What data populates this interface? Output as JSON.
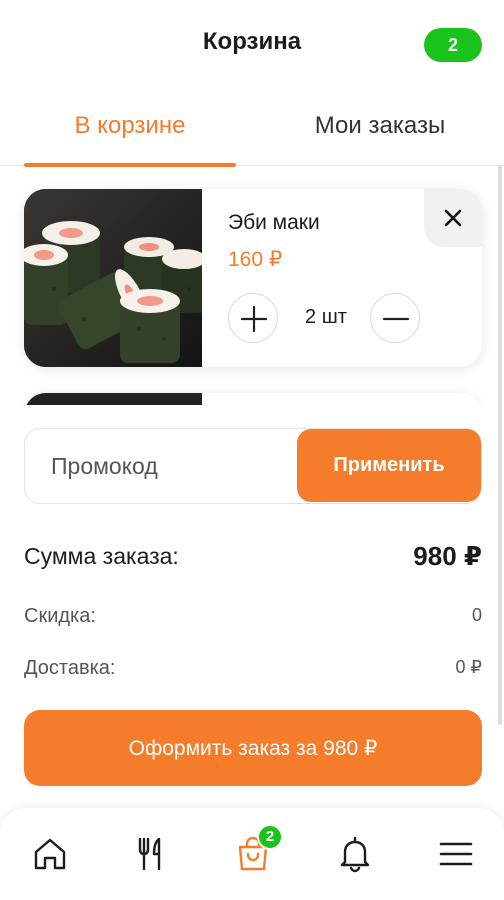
{
  "header": {
    "title": "Корзина",
    "badge_count": "2"
  },
  "tabs": [
    {
      "label": "В корзине",
      "active": true
    },
    {
      "label": "Мои заказы",
      "active": false
    }
  ],
  "cart_items": [
    {
      "name": "Эби маки",
      "price": "160 ₽",
      "quantity": "2 шт"
    }
  ],
  "promo": {
    "placeholder": "Промокод",
    "apply_label": "Применить"
  },
  "summary": {
    "total_label": "Сумма заказа:",
    "total_value": "980 ₽",
    "discount_label": "Скидка:",
    "discount_value": "0",
    "delivery_label": "Доставка:",
    "delivery_value": "0 ₽"
  },
  "checkout": {
    "label": "Оформить заказ за 980 ₽"
  },
  "bottom_nav": {
    "items": [
      {
        "icon": "home-icon"
      },
      {
        "icon": "cutlery-icon"
      },
      {
        "icon": "shopping-bag-icon",
        "badge": "2",
        "active": true
      },
      {
        "icon": "bell-icon"
      },
      {
        "icon": "hamburger-menu-icon"
      }
    ]
  },
  "colors": {
    "accent": "#f57c2b",
    "badge_green": "#19c31c",
    "text": "#1c1c1c"
  }
}
